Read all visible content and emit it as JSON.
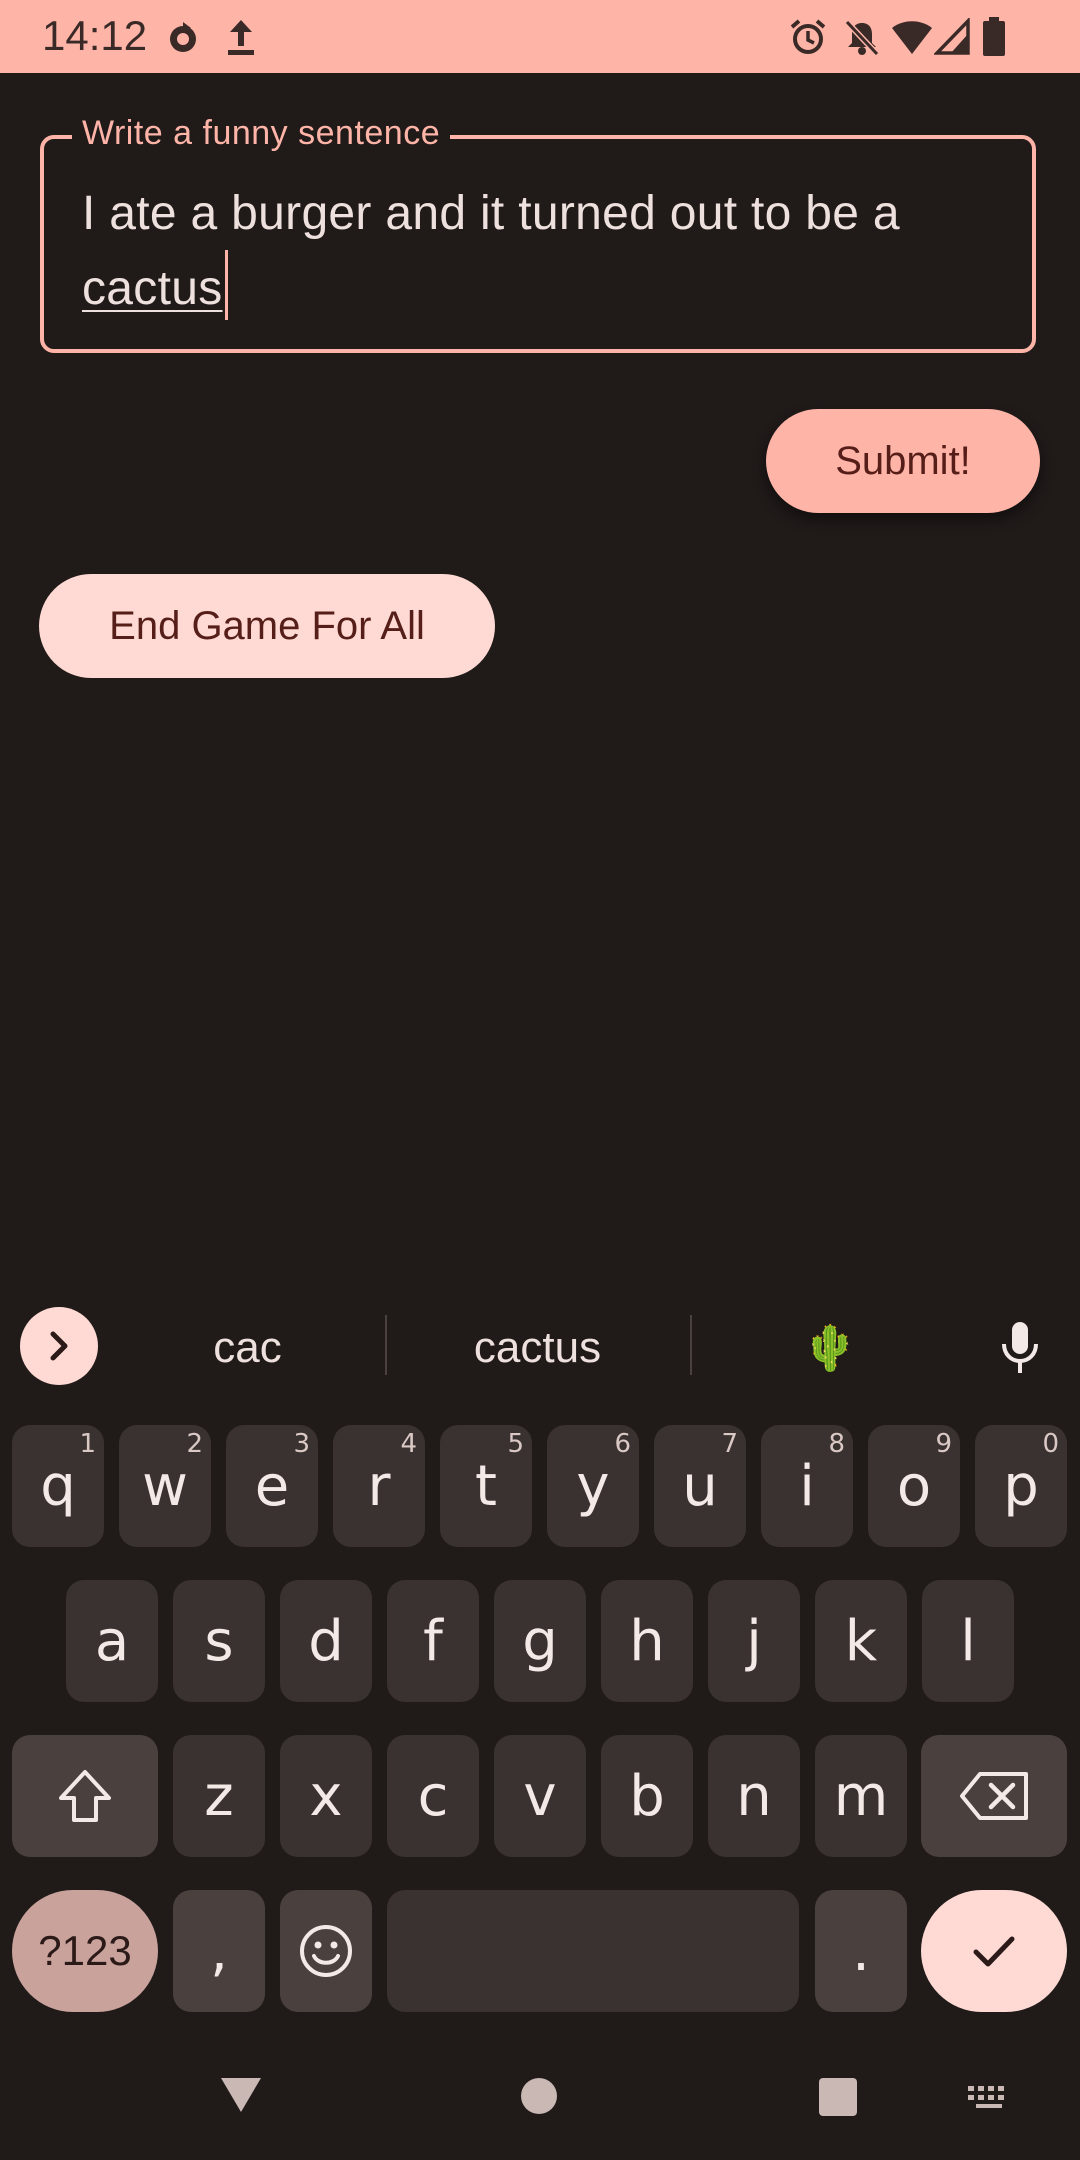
{
  "status_bar": {
    "time": "14:12",
    "icons": [
      "sync-icon",
      "upload-icon",
      "alarm-icon",
      "notifications-off-icon",
      "wifi-icon",
      "signal-icon",
      "battery-icon"
    ]
  },
  "form": {
    "label": "Write a funny sentence",
    "value_committed": "I ate a burger and it turned out to be a ",
    "value_composing": "cactus"
  },
  "buttons": {
    "submit": "Submit!",
    "end_game": "End Game For All"
  },
  "keyboard": {
    "suggestions": [
      "cac",
      "cactus",
      "🌵"
    ],
    "row1": [
      {
        "key": "q",
        "hint": "1"
      },
      {
        "key": "w",
        "hint": "2"
      },
      {
        "key": "e",
        "hint": "3"
      },
      {
        "key": "r",
        "hint": "4"
      },
      {
        "key": "t",
        "hint": "5"
      },
      {
        "key": "y",
        "hint": "6"
      },
      {
        "key": "u",
        "hint": "7"
      },
      {
        "key": "i",
        "hint": "8"
      },
      {
        "key": "o",
        "hint": "9"
      },
      {
        "key": "p",
        "hint": "0"
      }
    ],
    "row2": [
      "a",
      "s",
      "d",
      "f",
      "g",
      "h",
      "j",
      "k",
      "l"
    ],
    "row3": [
      "z",
      "x",
      "c",
      "v",
      "b",
      "n",
      "m"
    ],
    "symbols_label": "?123",
    "comma": ",",
    "period": "."
  },
  "colors": {
    "accent": "#ffb4a8",
    "accent_container": "#ffdad4",
    "background": "#201a19",
    "key": "#3a3230",
    "key_dark": "#4a403e"
  }
}
